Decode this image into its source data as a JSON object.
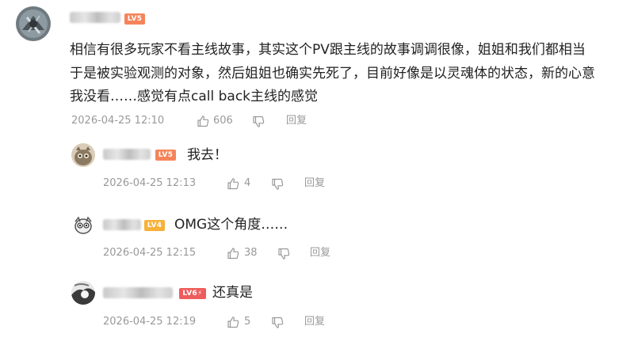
{
  "main_comment": {
    "level": "LV5",
    "text_lines": [
      "相信有很多玩家不看主线故事，其实这个PV跟主线的故事调调很像，姐姐和我们都相当",
      "于是被实验观测的对象，然后姐姐也确实先死了，目前好像是以灵魂体的状态，新的心意",
      "我没看……感觉有点call back主线的感觉"
    ],
    "time": "2026-04-25 12:10",
    "likes": "606",
    "reply_label": "回复"
  },
  "replies": [
    {
      "level": "LV5",
      "text": "我去！",
      "time": "2026-04-25 12:13",
      "likes": "4",
      "reply_label": "回复"
    },
    {
      "level": "LV4",
      "text": "OMG这个角度……",
      "time": "2026-04-25 12:15",
      "likes": "38",
      "reply_label": "回复"
    },
    {
      "level": "LV6⚡",
      "text": "还真是",
      "time": "2026-04-25 12:19",
      "likes": "5",
      "reply_label": "回复"
    }
  ],
  "icons": {
    "like": "thumbs-up-icon",
    "dislike": "thumbs-down-icon"
  },
  "colors": {
    "meta": "#999999",
    "lv5": "#f5845a",
    "lv4": "#f7b13a",
    "lv6": "#ef5c5c"
  }
}
